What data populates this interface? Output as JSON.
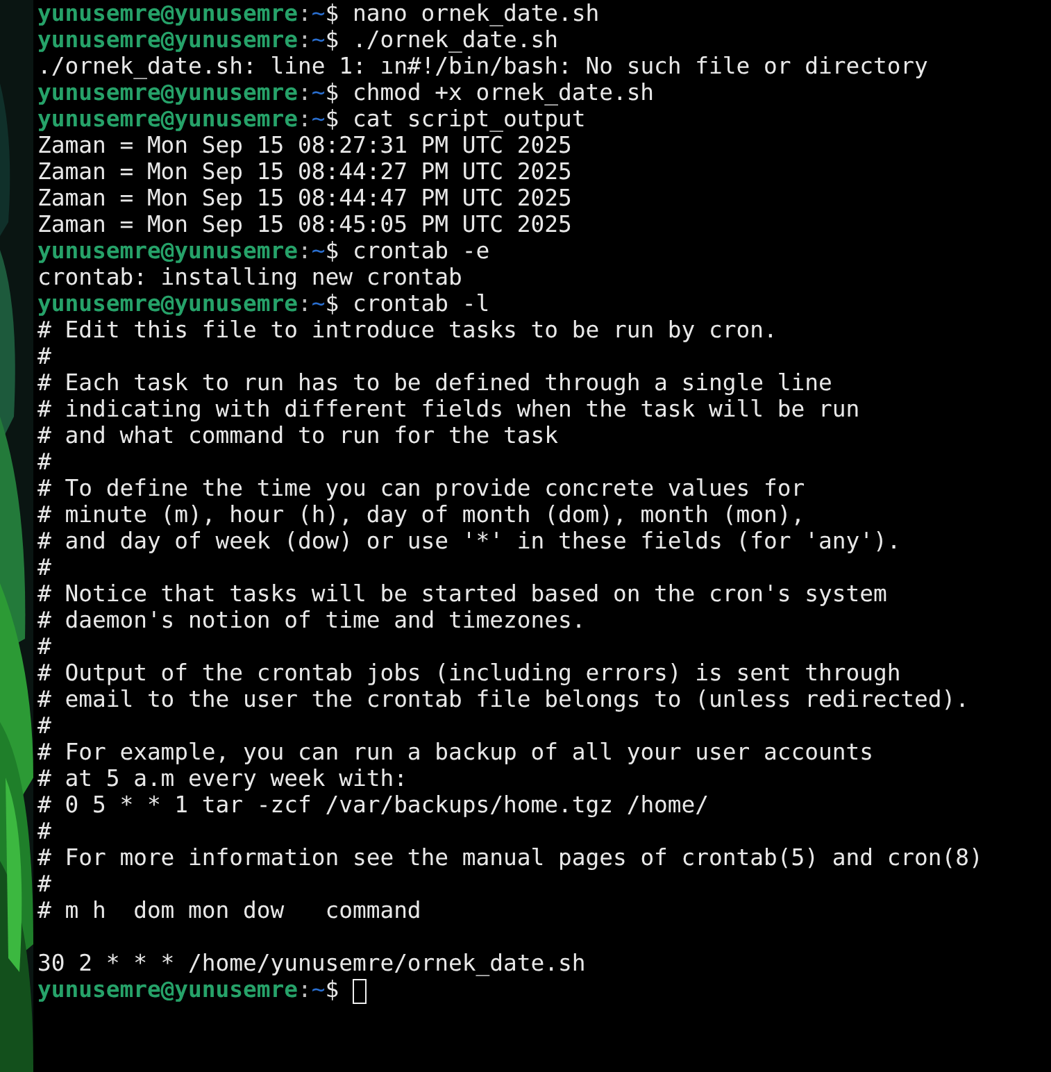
{
  "terminal": {
    "lines": [
      {
        "kind": "prompt",
        "user": "yunusemre@yunusemre",
        "separator": ":",
        "path": "~",
        "symbol": "$",
        "command": "nano ornek_date.sh",
        "cursor": false
      },
      {
        "kind": "prompt",
        "user": "yunusemre@yunusemre",
        "separator": ":",
        "path": "~",
        "symbol": "$",
        "command": "./ornek_date.sh",
        "cursor": false
      },
      {
        "kind": "output",
        "text": "./ornek_date.sh: line 1: ın#!/bin/bash: No such file or directory"
      },
      {
        "kind": "prompt",
        "user": "yunusemre@yunusemre",
        "separator": ":",
        "path": "~",
        "symbol": "$",
        "command": "chmod +x ornek_date.sh",
        "cursor": false
      },
      {
        "kind": "prompt",
        "user": "yunusemre@yunusemre",
        "separator": ":",
        "path": "~",
        "symbol": "$",
        "command": "cat script_output",
        "cursor": false
      },
      {
        "kind": "output",
        "text": "Zaman = Mon Sep 15 08:27:31 PM UTC 2025"
      },
      {
        "kind": "output",
        "text": "Zaman = Mon Sep 15 08:44:27 PM UTC 2025"
      },
      {
        "kind": "output",
        "text": "Zaman = Mon Sep 15 08:44:47 PM UTC 2025"
      },
      {
        "kind": "output",
        "text": "Zaman = Mon Sep 15 08:45:05 PM UTC 2025"
      },
      {
        "kind": "prompt",
        "user": "yunusemre@yunusemre",
        "separator": ":",
        "path": "~",
        "symbol": "$",
        "command": "crontab -e",
        "cursor": false
      },
      {
        "kind": "output",
        "text": "crontab: installing new crontab"
      },
      {
        "kind": "prompt",
        "user": "yunusemre@yunusemre",
        "separator": ":",
        "path": "~",
        "symbol": "$",
        "command": "crontab -l",
        "cursor": false
      },
      {
        "kind": "output",
        "text": "# Edit this file to introduce tasks to be run by cron."
      },
      {
        "kind": "output",
        "text": "#"
      },
      {
        "kind": "output",
        "text": "# Each task to run has to be defined through a single line"
      },
      {
        "kind": "output",
        "text": "# indicating with different fields when the task will be run"
      },
      {
        "kind": "output",
        "text": "# and what command to run for the task"
      },
      {
        "kind": "output",
        "text": "#"
      },
      {
        "kind": "output",
        "text": "# To define the time you can provide concrete values for"
      },
      {
        "kind": "output",
        "text": "# minute (m), hour (h), day of month (dom), month (mon),"
      },
      {
        "kind": "output",
        "text": "# and day of week (dow) or use '*' in these fields (for 'any')."
      },
      {
        "kind": "output",
        "text": "#"
      },
      {
        "kind": "output",
        "text": "# Notice that tasks will be started based on the cron's system"
      },
      {
        "kind": "output",
        "text": "# daemon's notion of time and timezones."
      },
      {
        "kind": "output",
        "text": "#"
      },
      {
        "kind": "output",
        "text": "# Output of the crontab jobs (including errors) is sent through"
      },
      {
        "kind": "output",
        "text": "# email to the user the crontab file belongs to (unless redirected)."
      },
      {
        "kind": "output",
        "text": "#"
      },
      {
        "kind": "output",
        "text": "# For example, you can run a backup of all your user accounts"
      },
      {
        "kind": "output",
        "text": "# at 5 a.m every week with:"
      },
      {
        "kind": "output",
        "text": "# 0 5 * * 1 tar -zcf /var/backups/home.tgz /home/"
      },
      {
        "kind": "output",
        "text": "#"
      },
      {
        "kind": "output",
        "text": "# For more information see the manual pages of crontab(5) and cron(8)"
      },
      {
        "kind": "output",
        "text": "#"
      },
      {
        "kind": "output",
        "text": "# m h  dom mon dow   command"
      },
      {
        "kind": "blank"
      },
      {
        "kind": "output",
        "text": "30 2 * * * /home/yunusemre/ornek_date.sh"
      },
      {
        "kind": "prompt",
        "user": "yunusemre@yunusemre",
        "separator": ":",
        "path": "~",
        "symbol": "$",
        "cursor": true
      }
    ]
  }
}
